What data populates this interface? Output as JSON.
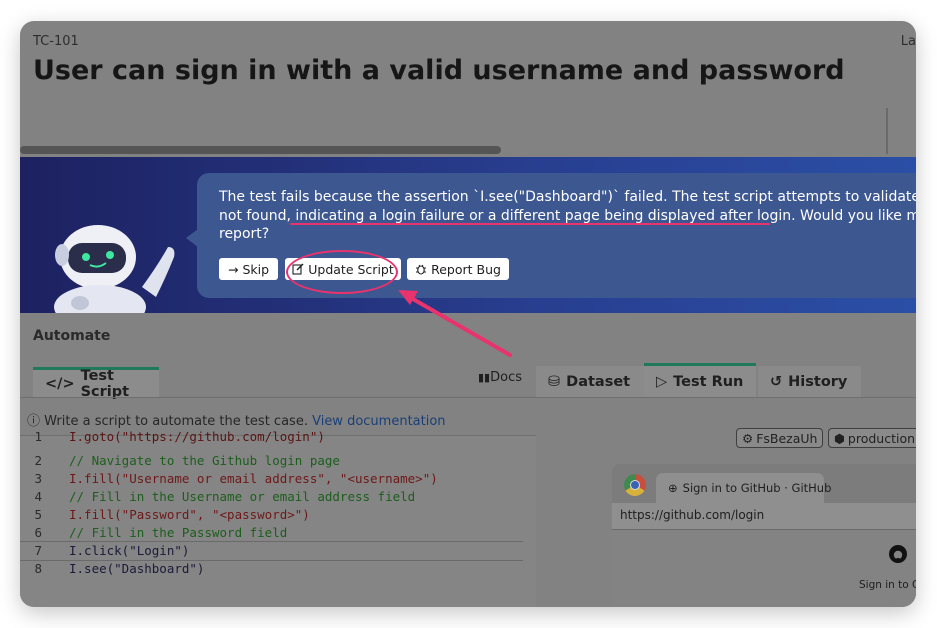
{
  "header": {
    "test_id": "TC-101",
    "right_text": "La",
    "title": "User can sign in with a valid username and password"
  },
  "banner": {
    "message_1": "The test fails because the assertion `I.see(\"Dashboard\")` failed. The test script attempts to validate the p",
    "message_2_pre": "not found, ",
    "message_2_highlight": "indicating a login failure or a different page being displayed after login",
    "message_2_post": ". Would you like me to",
    "message_3": "report?",
    "skip_label": "Skip",
    "update_label": "Update Script",
    "report_label": "Report Bug"
  },
  "automate": {
    "label": "Automate",
    "script_tab": "Test Script",
    "docs_label": "Docs",
    "info_text": "Write a script to automate the test case.",
    "info_link": "View documentation"
  },
  "code": [
    {
      "n": "1",
      "text": "I.goto(\"https://github.com/login\")"
    },
    {
      "n": "2",
      "text": "// Navigate to the Github login page"
    },
    {
      "n": "3",
      "text": "I.fill(\"Username or email address\", \"<username>\")"
    },
    {
      "n": "4",
      "text": "// Fill in the Username or email address field"
    },
    {
      "n": "5",
      "text": "I.fill(\"Password\", \"<password>\")"
    },
    {
      "n": "6",
      "text": "// Fill in the Password field"
    },
    {
      "n": "7",
      "text": "I.click(\"Login\")"
    },
    {
      "n": "8",
      "text": "I.see(\"Dashboard\")"
    }
  ],
  "right": {
    "tabs": [
      "Dataset",
      "Test Run",
      "History"
    ],
    "chip_1": "FsBezaUh",
    "chip_2": "production",
    "browser_tab": "Sign in to GitHub · GitHub",
    "url": "https://github.com/login",
    "page_text": "Sign in to G"
  },
  "colors": {
    "accent_green": "#1f7a5c",
    "annotation_red": "#e8336d",
    "banner_dark": "#1d2160",
    "code_string": "#7a1e1e",
    "code_comment": "#1c5e1c",
    "link": "#1a3f78"
  }
}
